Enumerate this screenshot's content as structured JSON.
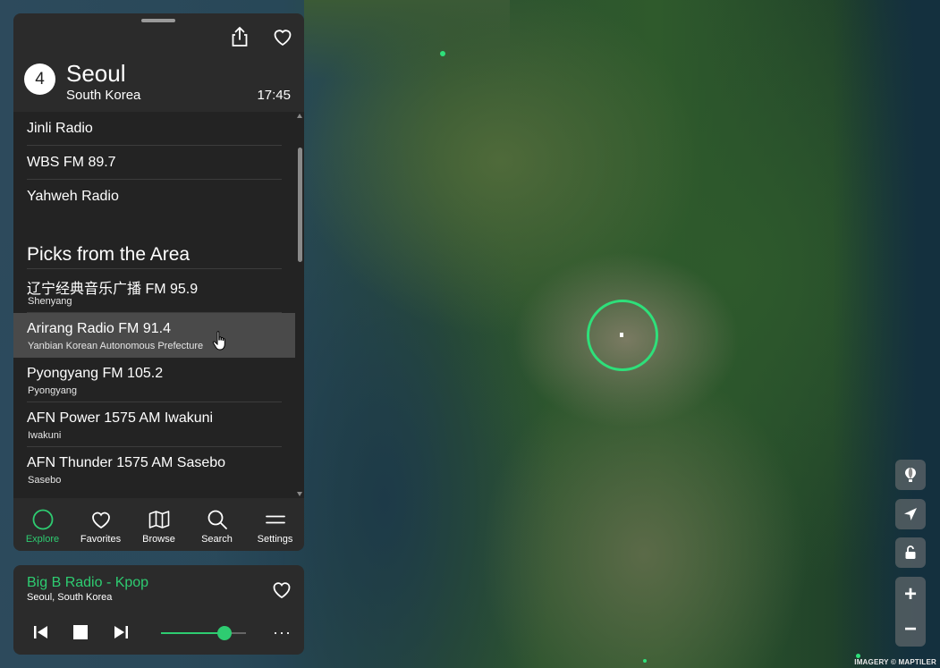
{
  "header": {
    "place_index": "4",
    "city": "Seoul",
    "country": "South Korea",
    "local_time": "17:45"
  },
  "station_list": {
    "top_items": [
      {
        "name": "Jinli Radio"
      },
      {
        "name": "WBS FM 89.7"
      },
      {
        "name": "Yahweh Radio"
      }
    ],
    "section_title": "Picks from the Area",
    "picks": [
      {
        "name": "辽宁经典音乐广播 FM 95.9",
        "location": "Shenyang"
      },
      {
        "name": "Arirang Radio FM 91.4",
        "location": "Yanbian Korean Autonomous Prefecture",
        "hovered": true
      },
      {
        "name": "Pyongyang FM 105.2",
        "location": "Pyongyang"
      },
      {
        "name": "AFN Power 1575 AM Iwakuni",
        "location": "Iwakuni"
      },
      {
        "name": "AFN Thunder 1575 AM Sasebo",
        "location": "Sasebo"
      }
    ]
  },
  "nav": {
    "explore": "Explore",
    "favorites": "Favorites",
    "browse": "Browse",
    "search": "Search",
    "settings": "Settings",
    "active": "explore"
  },
  "player": {
    "station": "Big B Radio - Kpop",
    "location": "Seoul, South Korea",
    "volume": 0.75,
    "more": "···"
  },
  "map": {
    "attribution": "IMAGERY © MAPTILER"
  },
  "colors": {
    "accent": "#2ecc71",
    "panel_bg": "#2b2b2b",
    "list_bg": "#232323"
  }
}
